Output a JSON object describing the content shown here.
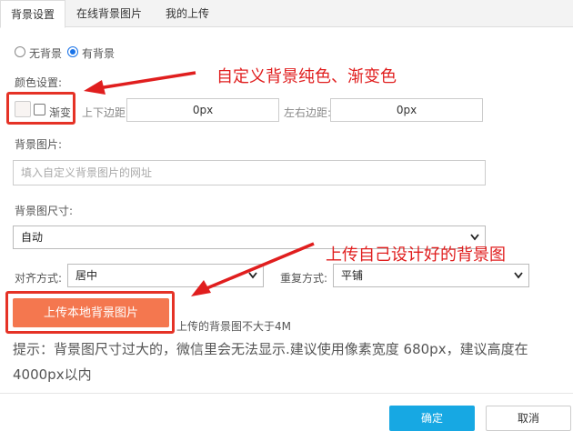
{
  "tabs": [
    {
      "label": "背景设置",
      "active": true
    },
    {
      "label": "在线背景图片",
      "active": false
    },
    {
      "label": "我的上传",
      "active": false
    }
  ],
  "background_mode": {
    "options": [
      "无背景",
      "有背景"
    ],
    "selected": "有背景"
  },
  "color": {
    "label": "颜色设置:",
    "gradient_label": "渐变",
    "margin_v_label": "上下边距:",
    "margin_v_value": "0px",
    "margin_h_label": "左右边距:",
    "margin_h_value": "0px"
  },
  "image": {
    "label": "背景图片:",
    "placeholder": "填入自定义背景图片的网址"
  },
  "size": {
    "label": "背景图尺寸:",
    "value": "自动"
  },
  "align": {
    "label": "对齐方式:",
    "value": "居中"
  },
  "repeat": {
    "label": "重复方式:",
    "value": "平铺"
  },
  "upload": {
    "button_label": "上传本地背景图片",
    "note": "上传的背景图不大于4M"
  },
  "hint": "提示：背景图尺寸过大的，微信里会无法显示.建议使用像素宽度 680px，建议高度在4000px以内",
  "annotations": {
    "color_note": "自定义背景纯色、渐变色",
    "upload_note": "上传自己设计好的背景图",
    "color": "#e01e1e"
  },
  "footer": {
    "ok_label": "确定",
    "cancel_label": "取消"
  },
  "colors": {
    "accent_orange": "#f4774f",
    "ok_blue": "#17a8e3",
    "annotation_red": "#e53226"
  }
}
